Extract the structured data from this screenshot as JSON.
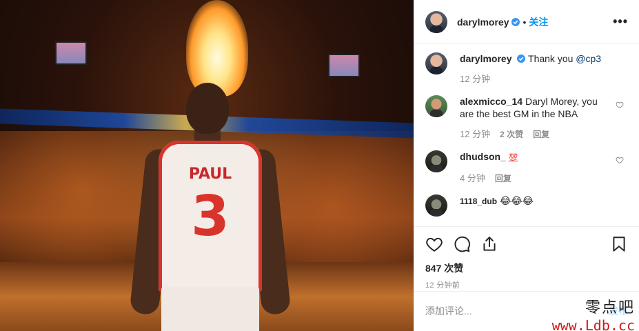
{
  "post": {
    "image_alt": "Chris Paul jersey PAUL 3 walking into arena",
    "jersey_name": "PAUL",
    "jersey_number": "3"
  },
  "header": {
    "username": "darylmorey",
    "verified": true,
    "separator": "•",
    "follow_label": "关注",
    "more_label": "•••"
  },
  "comments": [
    {
      "username": "darylmorey",
      "verified": true,
      "text": "Thank you ",
      "mention": "@cp3",
      "time": "12 分钟"
    },
    {
      "username": "alexmicco_14",
      "text": "Daryl Morey, you are the best GM in the NBA",
      "time": "12 分钟",
      "likes": "2 次赞",
      "reply": "回复"
    },
    {
      "username": "dhudson_",
      "text": "💯",
      "time": "4 分钟",
      "reply": "回复"
    },
    {
      "username": "1118_dub",
      "text": "😂😂😂"
    }
  ],
  "actions": {
    "likes_count": "847 次赞",
    "posted_time": "12 分钟前"
  },
  "add_comment": {
    "placeholder": "添加评论...",
    "post_label": "发布"
  },
  "watermark": {
    "line1": "零点吧",
    "line2": "www.Ldb.cc"
  },
  "colors": {
    "accent": "#0095f6",
    "text": "#262626",
    "muted": "#8e8e8e",
    "border": "#efefef"
  }
}
